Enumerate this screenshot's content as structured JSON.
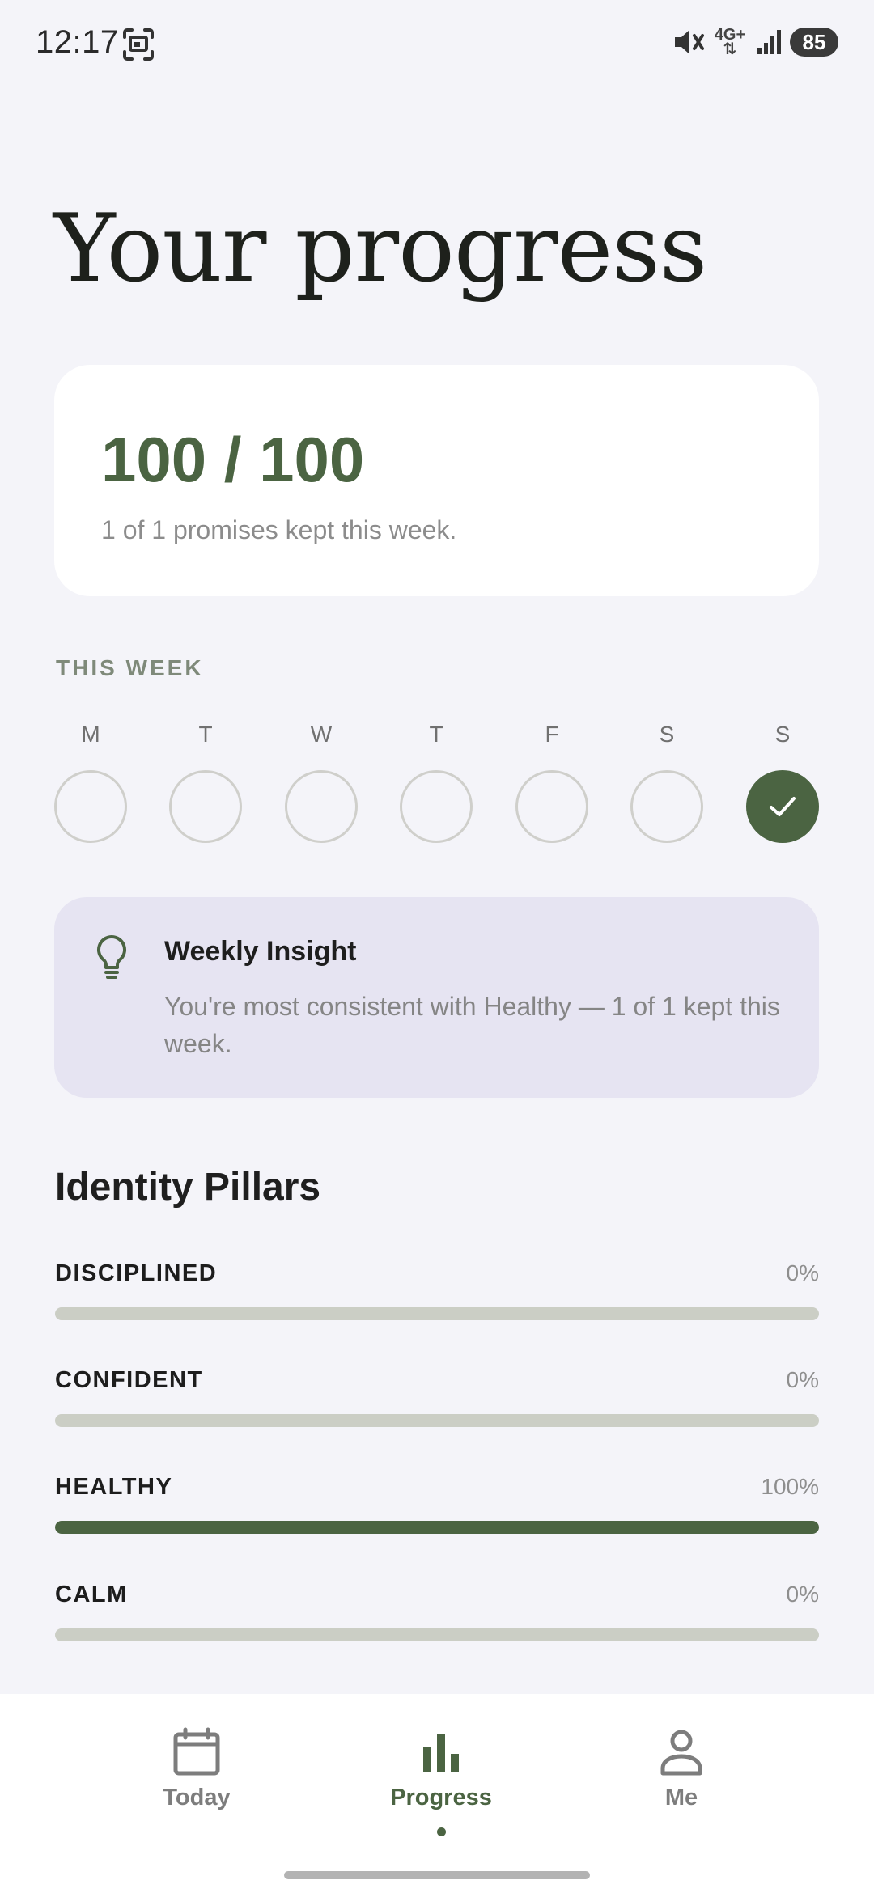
{
  "status_bar": {
    "time": "12:17",
    "network": "4G+",
    "battery": "85",
    "icons": [
      "screenshot-icon",
      "mute-icon",
      "signal-icon",
      "battery-icon"
    ]
  },
  "page": {
    "title": "Your progress"
  },
  "score": {
    "value": "100 / 100",
    "summary": "1 of 1 promises kept this week."
  },
  "week": {
    "label": "THIS WEEK",
    "days": [
      {
        "letter": "M",
        "done": false
      },
      {
        "letter": "T",
        "done": false
      },
      {
        "letter": "W",
        "done": false
      },
      {
        "letter": "T",
        "done": false
      },
      {
        "letter": "F",
        "done": false
      },
      {
        "letter": "S",
        "done": false
      },
      {
        "letter": "S",
        "done": true
      }
    ]
  },
  "insight": {
    "title": "Weekly Insight",
    "body": "You're most consistent with Healthy — 1 of 1 kept this week.",
    "icon": "lightbulb-icon"
  },
  "pillars": {
    "title": "Identity Pillars",
    "items": [
      {
        "name": "DISCIPLINED",
        "percent_label": "0%",
        "progress": 0
      },
      {
        "name": "CONFIDENT",
        "percent_label": "0%",
        "progress": 0
      },
      {
        "name": "HEALTHY",
        "percent_label": "100%",
        "progress": 100
      },
      {
        "name": "CALM",
        "percent_label": "0%",
        "progress": 0
      }
    ]
  },
  "nav": {
    "items": [
      {
        "label": "Today",
        "icon": "calendar-icon",
        "active": false
      },
      {
        "label": "Progress",
        "icon": "bar-chart-icon",
        "active": true
      },
      {
        "label": "Me",
        "icon": "person-icon",
        "active": false
      }
    ]
  },
  "colors": {
    "accent": "#4b6442",
    "background": "#f4f4f9",
    "insight_background": "#e6e4f2",
    "track": "#cbcec5"
  }
}
